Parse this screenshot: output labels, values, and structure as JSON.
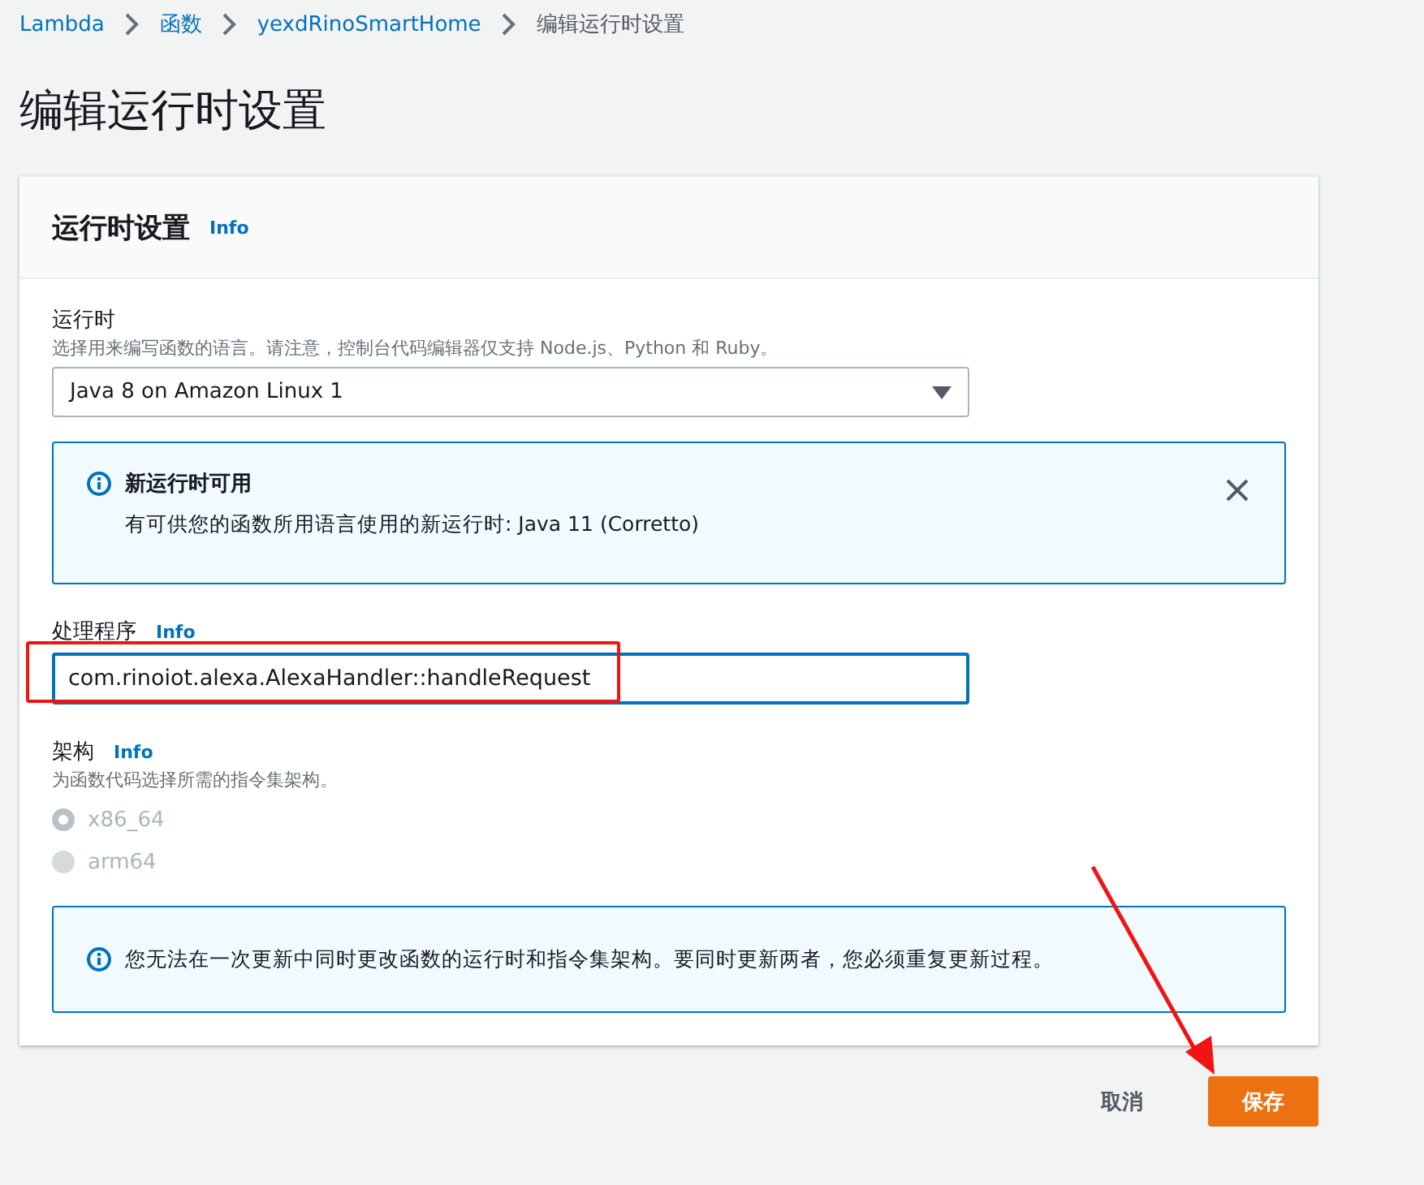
{
  "breadcrumb": [
    {
      "label": "Lambda",
      "link": true
    },
    {
      "label": "函数",
      "link": true
    },
    {
      "label": "yexdRinoSmartHome",
      "link": true
    },
    {
      "label": "编辑运行时设置",
      "link": false
    }
  ],
  "page_title": "编辑运行时设置",
  "card": {
    "title": "运行时设置",
    "info": "Info",
    "runtime": {
      "label": "运行时",
      "description": "选择用来编写函数的语言。请注意，控制台代码编辑器仅支持 Node.js、Python 和 Ruby。",
      "value": "Java 8 on Amazon Linux 1"
    },
    "runtime_alert": {
      "title": "新运行时可用",
      "message": "有可供您的函数所用语言使用的新运行时: Java 11 (Corretto)",
      "dismissible": true
    },
    "handler": {
      "label": "处理程序",
      "info": "Info",
      "value": "com.rinoiot.alexa.AlexaHandler::handleRequest",
      "highlighted": true
    },
    "architecture": {
      "label": "架构",
      "info": "Info",
      "description": "为函数代码选择所需的指令集架构。",
      "options": [
        {
          "label": "x86_64",
          "selected": true,
          "disabled": true
        },
        {
          "label": "arm64",
          "selected": false,
          "disabled": true
        }
      ]
    },
    "arch_alert": {
      "message": "您无法在一次更新中同时更改函数的运行时和指令集架构。要同时更新两者，您必须重复更新过程。"
    }
  },
  "actions": [
    {
      "label": "取消",
      "kind": "link"
    },
    {
      "label": "保存",
      "kind": "primary"
    }
  ],
  "arrow_annotation": true
}
